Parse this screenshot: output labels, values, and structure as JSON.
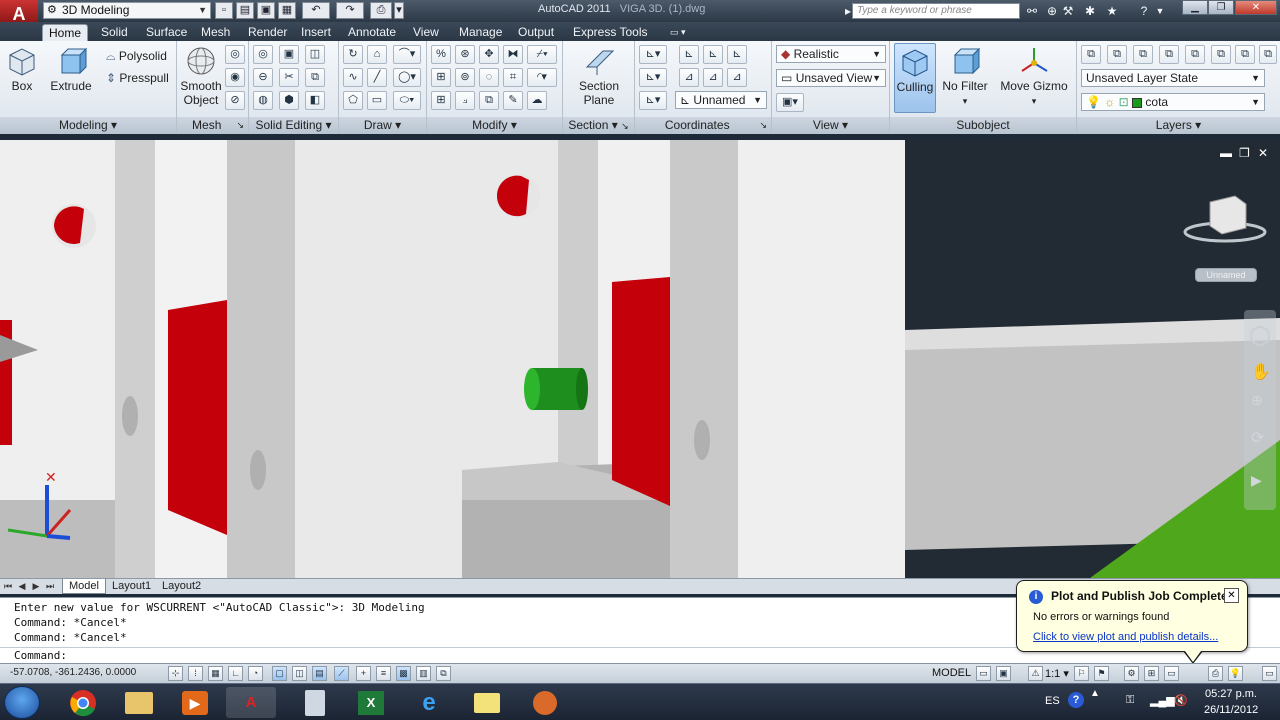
{
  "app": {
    "title": "AutoCAD 2011",
    "file": "VIGA 3D. (1).dwg",
    "workspace": "3D Modeling",
    "search_placeholder": "Type a keyword or phrase"
  },
  "tabs": [
    "Home",
    "Solid",
    "Surface",
    "Mesh",
    "Render",
    "Insert",
    "Annotate",
    "View",
    "Manage",
    "Output",
    "Express Tools"
  ],
  "ribbon": {
    "modeling": {
      "title": "Modeling",
      "box": "Box",
      "extrude": "Extrude",
      "polysolid": "Polysolid",
      "presspull": "Presspull"
    },
    "mesh": {
      "title": "Mesh",
      "smooth1": "Smooth",
      "smooth2": "Object"
    },
    "solid_editing": {
      "title": "Solid Editing"
    },
    "draw": {
      "title": "Draw"
    },
    "modify": {
      "title": "Modify"
    },
    "section": {
      "title": "Section",
      "plane1": "Section",
      "plane2": "Plane"
    },
    "coordinates": {
      "title": "Coordinates",
      "ucs": "Unnamed"
    },
    "view": {
      "title": "View",
      "visual_style": "Realistic",
      "saved_view": "Unsaved View"
    },
    "subobject": {
      "title": "Subobject",
      "culling": "Culling",
      "filter": "No Filter",
      "gizmo": "Move Gizmo"
    },
    "layers": {
      "title": "Layers",
      "layer_state": "Unsaved Layer State",
      "layer": "cota"
    }
  },
  "viewport": {
    "viewcube_label": "Unnamed"
  },
  "layout_tabs": [
    "Model",
    "Layout1",
    "Layout2"
  ],
  "command": {
    "history": [
      "Enter new value for WSCURRENT <\"AutoCAD Classic\">: 3D Modeling",
      "Command: *Cancel*",
      "Command: *Cancel*"
    ],
    "prompt": "Command:"
  },
  "status": {
    "coords": "-57.0708, -361.2436, 0.0000",
    "model": "MODEL",
    "scale": "1:1"
  },
  "notification": {
    "title": "Plot and Publish Job Complete",
    "message": "No errors or warnings found",
    "link": "Click to view plot and publish details..."
  },
  "taskbar": {
    "lang": "ES",
    "time": "05:27 p.m.",
    "date": "26/11/2012"
  }
}
